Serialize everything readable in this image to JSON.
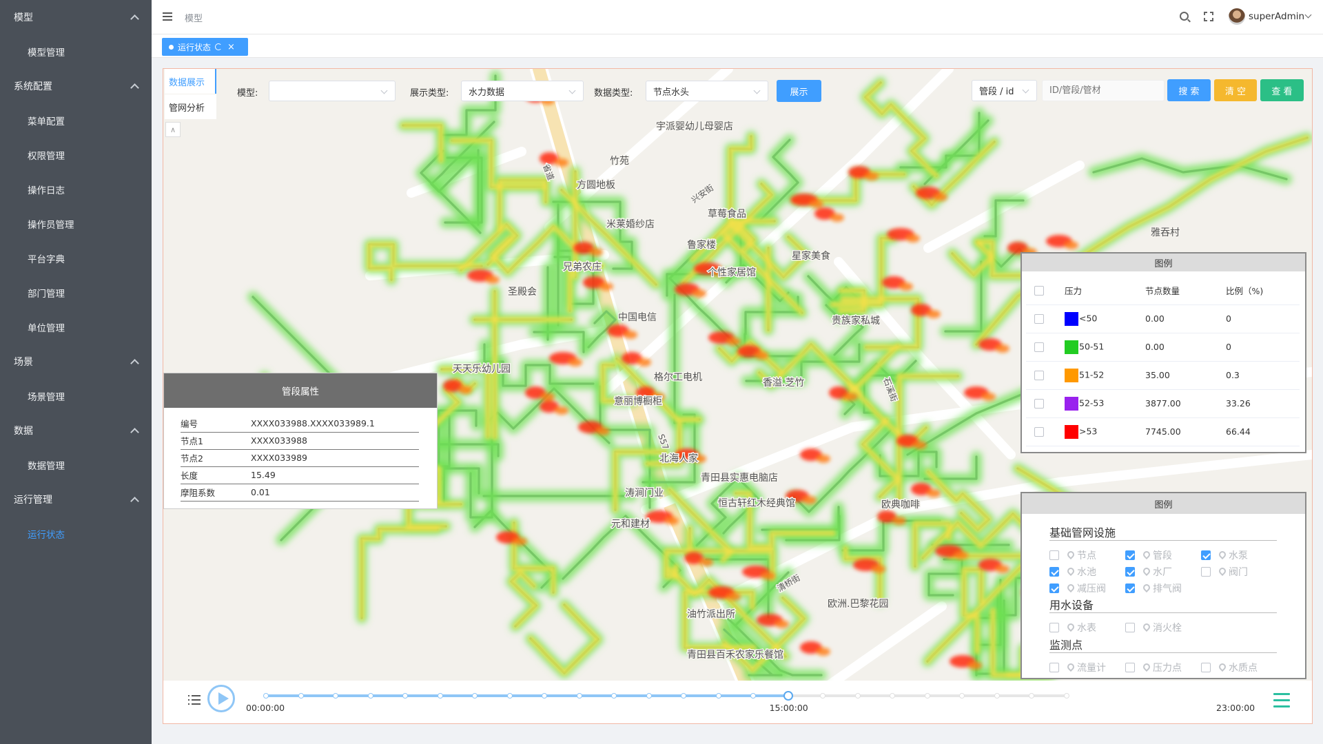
{
  "sidebar": {
    "groups": [
      {
        "label": "模型",
        "items": [
          "模型管理"
        ]
      },
      {
        "label": "系统配置",
        "items": [
          "菜单配置",
          "权限管理",
          "操作日志",
          "操作员管理",
          "平台字典",
          "部门管理",
          "单位管理"
        ]
      },
      {
        "label": "场景",
        "items": [
          "场景管理"
        ]
      },
      {
        "label": "数据",
        "items": [
          "数据管理"
        ]
      },
      {
        "label": "运行管理",
        "items": [
          "运行状态"
        ]
      }
    ],
    "active_item": "运行状态"
  },
  "header": {
    "breadcrumb": "模型",
    "username": "superAdmin"
  },
  "tabs": [
    {
      "label": "运行状态",
      "active": true
    }
  ],
  "side_tabs": [
    "数据展示",
    "管网分析"
  ],
  "filters": {
    "model_label": "模型:",
    "model_value": "",
    "display_type_label": "展示类型:",
    "display_type_value": "水力数据",
    "data_type_label": "数据类型:",
    "data_type_value": "节点水头",
    "show_button": "展示",
    "search_field_select": "管段 / id",
    "search_placeholder": "ID/管段/管材",
    "search_button": "搜 索",
    "clear_button": "清 空",
    "view_button": "查 看"
  },
  "pipe_properties": {
    "title": "管段属性",
    "rows": [
      {
        "key": "编号",
        "value": "XXXX033988.XXXX033989.1"
      },
      {
        "key": "节点1",
        "value": "XXXX033988"
      },
      {
        "key": "节点2",
        "value": "XXXX033989"
      },
      {
        "key": "长度",
        "value": "15.49"
      },
      {
        "key": "摩阻系数",
        "value": "0.01"
      }
    ]
  },
  "pressure_legend": {
    "title": "图例",
    "columns": [
      "压力",
      "节点数量",
      "比例（%)"
    ],
    "rows": [
      {
        "range": "<50",
        "color": "#0000ff",
        "count": "0.00",
        "ratio": "0"
      },
      {
        "range": "50-51",
        "color": "#22cc22",
        "count": "0.00",
        "ratio": "0"
      },
      {
        "range": "51-52",
        "color": "#ff9900",
        "count": "35.00",
        "ratio": "0.3"
      },
      {
        "range": "52-53",
        "color": "#9922ee",
        "count": "3877.00",
        "ratio": "33.26"
      },
      {
        "range": ">53",
        "color": "#ff0000",
        "count": "7745.00",
        "ratio": "66.44"
      }
    ]
  },
  "layer_legend": {
    "title": "图例",
    "sections": [
      {
        "title": "基础管网设施",
        "items": [
          {
            "label": "节点",
            "checked": false
          },
          {
            "label": "管段",
            "checked": true
          },
          {
            "label": "水泵",
            "checked": true
          },
          {
            "label": "水池",
            "checked": true
          },
          {
            "label": "水厂",
            "checked": true
          },
          {
            "label": "阀门",
            "checked": false
          },
          {
            "label": "减压阀",
            "checked": true
          },
          {
            "label": "排气阀",
            "checked": true
          }
        ]
      },
      {
        "title": "用水设备",
        "items": [
          {
            "label": "水表",
            "checked": false
          },
          {
            "label": "消火栓",
            "checked": false
          }
        ]
      },
      {
        "title": "监测点",
        "items": [
          {
            "label": "流量计",
            "checked": false
          },
          {
            "label": "压力点",
            "checked": false
          },
          {
            "label": "水质点",
            "checked": false
          }
        ]
      }
    ]
  },
  "map_labels": [
    "宇派婴幼儿母婴店",
    "竹苑",
    "方圆地板",
    "米莱婚纱店",
    "兄弟农庄",
    "圣殿会",
    "天天乐幼儿园",
    "草莓食品",
    "鲁家楼",
    "个性家居馆",
    "星家美食",
    "中国电信",
    "格尔工电机",
    "意丽博橱柜",
    "香溢.芝竹",
    "贵族家私城",
    "北海人家",
    "涛涧门业",
    "元和建材",
    "青田县实惠电脑店",
    "恒古轩红木经典馆",
    "欧典咖啡",
    "油竹派出所",
    "青田县百禾农家乐餐馆",
    "欧洲.巴黎花园",
    "雅吞村",
    "S57",
    "省道",
    "清桥街",
    "兴安街",
    "石溪街"
  ],
  "timeline": {
    "start": "00:00:00",
    "current": "15:00:00",
    "end": "23:00:00",
    "position_fraction": 0.652
  }
}
